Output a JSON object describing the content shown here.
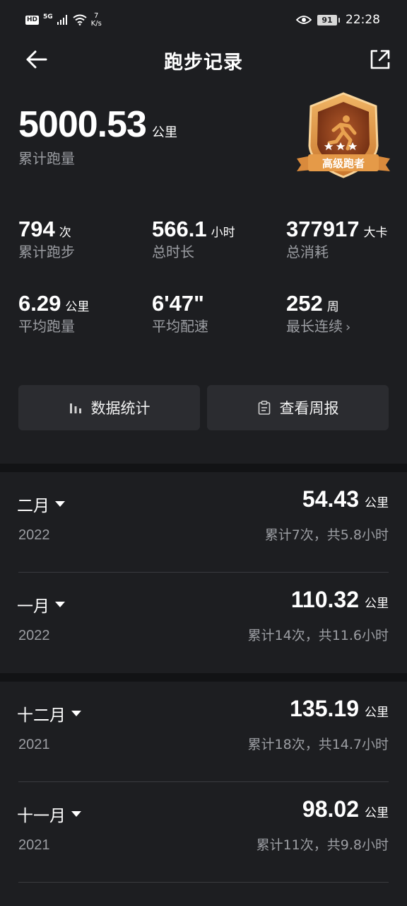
{
  "status_bar": {
    "hd": "HD",
    "network": "5G",
    "speed_value": "7",
    "speed_unit": "K/s",
    "battery": "91",
    "time": "22:28",
    "icons": [
      "signal-icon",
      "wifi-icon",
      "eye-icon",
      "battery-icon"
    ]
  },
  "nav": {
    "title": "跑步记录",
    "back_icon": "arrow-left-icon",
    "share_icon": "share-icon"
  },
  "summary": {
    "total_distance": "5000.53",
    "total_unit": "公里",
    "total_label": "累计跑量",
    "badge_text": "高级跑者"
  },
  "stats": [
    {
      "value": "794",
      "unit": "次",
      "label": "累计跑步"
    },
    {
      "value": "566.1",
      "unit": "小时",
      "label": "总时长"
    },
    {
      "value": "377917",
      "unit": "大卡",
      "label": "总消耗"
    },
    {
      "value": "6.29",
      "unit": "公里",
      "label": "平均跑量"
    },
    {
      "value": "6'47\"",
      "unit": "",
      "label": "平均配速"
    },
    {
      "value": "252",
      "unit": "周",
      "label": "最长连续",
      "chevron": "›"
    }
  ],
  "buttons": {
    "stats_label": "数据统计",
    "weekly_label": "查看周报"
  },
  "months": [
    {
      "month": "二月",
      "year": "2022",
      "distance": "54.43",
      "unit": "公里",
      "summary": "累计7次，共5.8小时"
    },
    {
      "month": "一月",
      "year": "2022",
      "distance": "110.32",
      "unit": "公里",
      "summary": "累计14次，共11.6小时"
    },
    {
      "month": "十二月",
      "year": "2021",
      "distance": "135.19",
      "unit": "公里",
      "summary": "累计18次，共14.7小时"
    },
    {
      "month": "十一月",
      "year": "2021",
      "distance": "98.02",
      "unit": "公里",
      "summary": "累计11次，共9.8小时"
    }
  ],
  "colors": {
    "background": "#1d1e21",
    "card": "#2b2c30",
    "secondary_text": "#9c9ea3",
    "badge_gold": "#d98a3c"
  }
}
